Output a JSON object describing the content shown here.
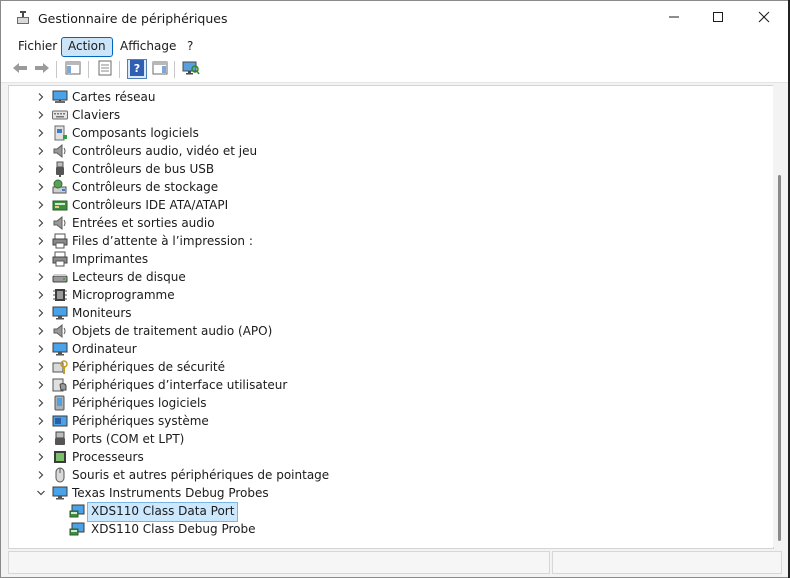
{
  "window": {
    "title": "Gestionnaire de périphériques"
  },
  "menu": {
    "items": [
      {
        "label": "Fichier"
      },
      {
        "label": "Action"
      },
      {
        "label": "Affichage"
      },
      {
        "label": "?"
      }
    ],
    "active": "Action"
  },
  "toolbar": {
    "buttons": [
      "back-arrow-icon",
      "forward-arrow-icon",
      "show-hide-console-tree-icon",
      "properties-icon",
      "help-icon",
      "action-pane-icon",
      "scan-hardware-icon"
    ]
  },
  "tree": {
    "items": [
      {
        "label": "Cartes réseau",
        "icon": "network-adapter-icon",
        "expanded": false
      },
      {
        "label": "Claviers",
        "icon": "keyboard-icon",
        "expanded": false
      },
      {
        "label": "Composants logiciels",
        "icon": "software-component-icon",
        "expanded": false
      },
      {
        "label": "Contrôleurs audio, vidéo et jeu",
        "icon": "speaker-icon",
        "expanded": false
      },
      {
        "label": "Contrôleurs de bus USB",
        "icon": "usb-icon",
        "expanded": false
      },
      {
        "label": "Contrôleurs de stockage",
        "icon": "storage-controller-icon",
        "expanded": false
      },
      {
        "label": "Contrôleurs IDE ATA/ATAPI",
        "icon": "ide-controller-icon",
        "expanded": false
      },
      {
        "label": "Entrées et sorties audio",
        "icon": "audio-io-icon",
        "expanded": false
      },
      {
        "label": "Files d’attente à l’impression :",
        "icon": "print-queue-icon",
        "expanded": false
      },
      {
        "label": "Imprimantes",
        "icon": "printer-icon",
        "expanded": false
      },
      {
        "label": "Lecteurs de disque",
        "icon": "disk-drive-icon",
        "expanded": false
      },
      {
        "label": "Microprogramme",
        "icon": "firmware-icon",
        "expanded": false
      },
      {
        "label": "Moniteurs",
        "icon": "monitor-icon",
        "expanded": false
      },
      {
        "label": "Objets de traitement audio (APO)",
        "icon": "audio-processing-icon",
        "expanded": false
      },
      {
        "label": "Ordinateur",
        "icon": "computer-icon",
        "expanded": false
      },
      {
        "label": "Périphériques de sécurité",
        "icon": "security-device-icon",
        "expanded": false
      },
      {
        "label": "Périphériques d’interface utilisateur",
        "icon": "hid-icon",
        "expanded": false
      },
      {
        "label": "Périphériques logiciels",
        "icon": "software-device-icon",
        "expanded": false
      },
      {
        "label": "Périphériques système",
        "icon": "system-device-icon",
        "expanded": false
      },
      {
        "label": "Ports (COM et LPT)",
        "icon": "port-icon",
        "expanded": false
      },
      {
        "label": "Processeurs",
        "icon": "processor-icon",
        "expanded": false
      },
      {
        "label": "Souris et autres périphériques de pointage",
        "icon": "mouse-icon",
        "expanded": false
      },
      {
        "label": "Texas Instruments Debug Probes",
        "icon": "debug-probe-icon",
        "expanded": true
      }
    ],
    "children": [
      {
        "label": "XDS110 Class Data Port",
        "icon": "debug-probe-device-icon",
        "selected": true
      },
      {
        "label": "XDS110 Class Debug Probe",
        "icon": "debug-probe-device-icon",
        "selected": false
      }
    ]
  },
  "colors": {
    "selection": "#cce8ff",
    "menu_active": "#cce4f7",
    "accent": "#0067c0"
  }
}
